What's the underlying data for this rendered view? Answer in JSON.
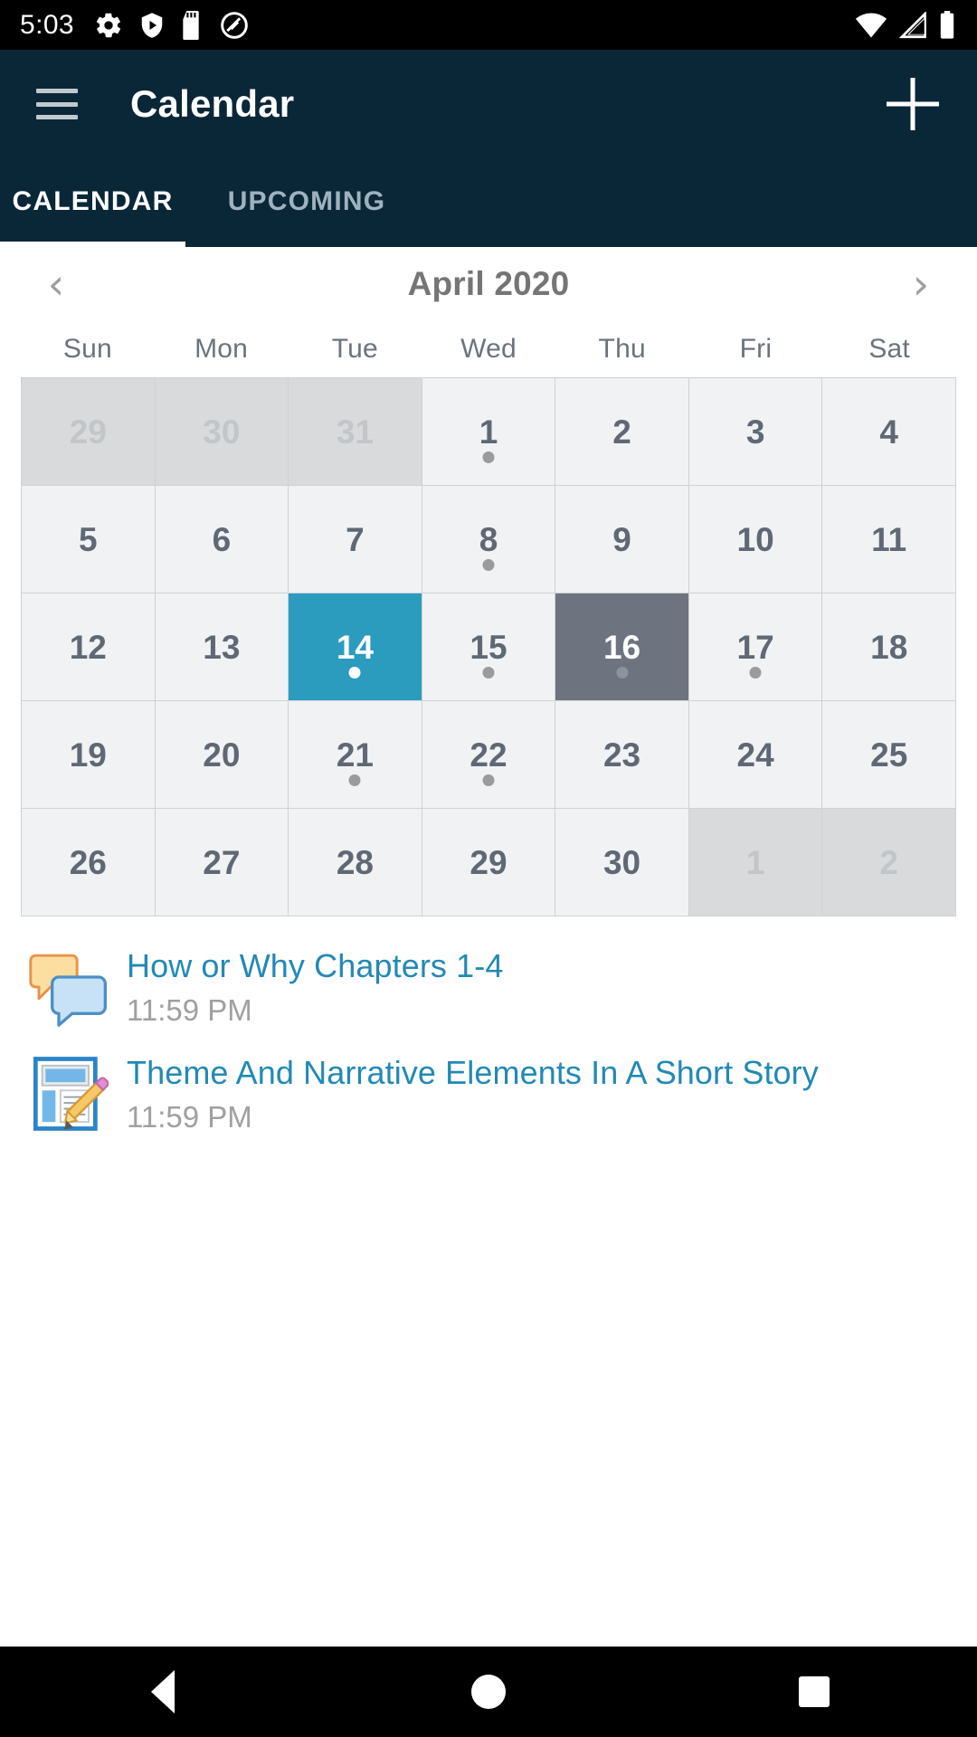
{
  "status_bar": {
    "time": "5:03",
    "left_icons": [
      "settings-gear-icon",
      "play-protect-shield-icon",
      "sd-card-icon",
      "do-not-disturb-icon"
    ],
    "right_icons": [
      "wifi-icon",
      "cellular-signal-icon",
      "battery-icon"
    ]
  },
  "app_bar": {
    "title": "Calendar",
    "menu_icon": "hamburger-menu-icon",
    "add_icon": "plus-icon"
  },
  "tabs": {
    "items": [
      {
        "label": "CALENDAR",
        "active": true
      },
      {
        "label": "UPCOMING",
        "active": false
      }
    ]
  },
  "month_header": {
    "prev_label": "‹",
    "next_label": "›",
    "title": "April 2020"
  },
  "weekdays": [
    "Sun",
    "Mon",
    "Tue",
    "Wed",
    "Thu",
    "Fri",
    "Sat"
  ],
  "calendar": {
    "weeks": [
      [
        {
          "day": "29",
          "other": true,
          "dot": false,
          "selected": false,
          "today": false
        },
        {
          "day": "30",
          "other": true,
          "dot": false,
          "selected": false,
          "today": false
        },
        {
          "day": "31",
          "other": true,
          "dot": false,
          "selected": false,
          "today": false
        },
        {
          "day": "1",
          "other": false,
          "dot": true,
          "selected": false,
          "today": false
        },
        {
          "day": "2",
          "other": false,
          "dot": false,
          "selected": false,
          "today": false
        },
        {
          "day": "3",
          "other": false,
          "dot": false,
          "selected": false,
          "today": false
        },
        {
          "day": "4",
          "other": false,
          "dot": false,
          "selected": false,
          "today": false
        }
      ],
      [
        {
          "day": "5",
          "other": false,
          "dot": false,
          "selected": false,
          "today": false
        },
        {
          "day": "6",
          "other": false,
          "dot": false,
          "selected": false,
          "today": false
        },
        {
          "day": "7",
          "other": false,
          "dot": false,
          "selected": false,
          "today": false
        },
        {
          "day": "8",
          "other": false,
          "dot": true,
          "selected": false,
          "today": false
        },
        {
          "day": "9",
          "other": false,
          "dot": false,
          "selected": false,
          "today": false
        },
        {
          "day": "10",
          "other": false,
          "dot": false,
          "selected": false,
          "today": false
        },
        {
          "day": "11",
          "other": false,
          "dot": false,
          "selected": false,
          "today": false
        }
      ],
      [
        {
          "day": "12",
          "other": false,
          "dot": false,
          "selected": false,
          "today": false
        },
        {
          "day": "13",
          "other": false,
          "dot": false,
          "selected": false,
          "today": false
        },
        {
          "day": "14",
          "other": false,
          "dot": true,
          "selected": true,
          "today": false
        },
        {
          "day": "15",
          "other": false,
          "dot": true,
          "selected": false,
          "today": false
        },
        {
          "day": "16",
          "other": false,
          "dot": true,
          "selected": false,
          "today": true
        },
        {
          "day": "17",
          "other": false,
          "dot": true,
          "selected": false,
          "today": false
        },
        {
          "day": "18",
          "other": false,
          "dot": false,
          "selected": false,
          "today": false
        }
      ],
      [
        {
          "day": "19",
          "other": false,
          "dot": false,
          "selected": false,
          "today": false
        },
        {
          "day": "20",
          "other": false,
          "dot": false,
          "selected": false,
          "today": false
        },
        {
          "day": "21",
          "other": false,
          "dot": true,
          "selected": false,
          "today": false
        },
        {
          "day": "22",
          "other": false,
          "dot": true,
          "selected": false,
          "today": false
        },
        {
          "day": "23",
          "other": false,
          "dot": false,
          "selected": false,
          "today": false
        },
        {
          "day": "24",
          "other": false,
          "dot": false,
          "selected": false,
          "today": false
        },
        {
          "day": "25",
          "other": false,
          "dot": false,
          "selected": false,
          "today": false
        }
      ],
      [
        {
          "day": "26",
          "other": false,
          "dot": false,
          "selected": false,
          "today": false
        },
        {
          "day": "27",
          "other": false,
          "dot": false,
          "selected": false,
          "today": false
        },
        {
          "day": "28",
          "other": false,
          "dot": false,
          "selected": false,
          "today": false
        },
        {
          "day": "29",
          "other": false,
          "dot": false,
          "selected": false,
          "today": false
        },
        {
          "day": "30",
          "other": false,
          "dot": false,
          "selected": false,
          "today": false
        },
        {
          "day": "1",
          "other": true,
          "dot": false,
          "selected": false,
          "today": false
        },
        {
          "day": "2",
          "other": true,
          "dot": false,
          "selected": false,
          "today": false
        }
      ]
    ]
  },
  "events": [
    {
      "icon": "discussion-bubbles-icon",
      "title": "How or Why Chapters 1-4",
      "time": "11:59 PM"
    },
    {
      "icon": "assignment-pencil-icon",
      "title": "Theme And Narrative Elements In A Short Story",
      "time": "11:59 PM"
    }
  ],
  "nav_bar": {
    "back_icon": "back-triangle-icon",
    "home_icon": "home-circle-icon",
    "recents_icon": "recents-square-icon"
  },
  "colors": {
    "app_bar": "#0a2738",
    "selected_day": "#2b9bbe",
    "today": "#6d7480",
    "event_link": "#2289b5"
  }
}
